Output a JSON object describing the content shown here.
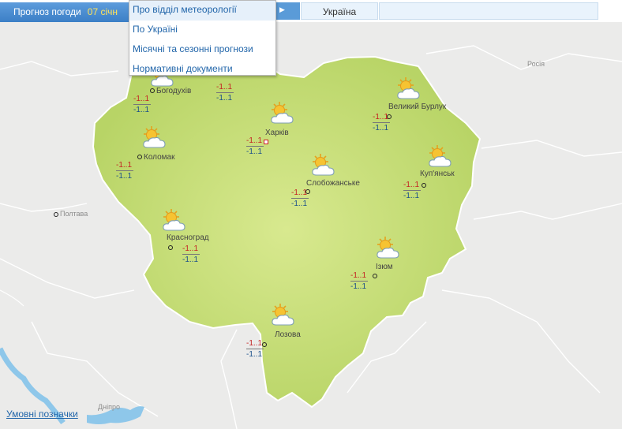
{
  "header": {
    "forecast_label": "Прогноз погоди",
    "date": "07 січн",
    "country_tab": "Україна"
  },
  "menu": {
    "items": [
      {
        "label": "Про відділ метеорології"
      },
      {
        "label": "По Україні"
      },
      {
        "label": "Місячні та сезонні прогнози"
      },
      {
        "label": "Нормативні документи"
      }
    ]
  },
  "map": {
    "neighbors": {
      "russia": "Росія",
      "poltava": "Полтава",
      "dnipro": "Дніпро"
    },
    "region_color": "#c6dc76",
    "cities": [
      {
        "name": "Богодухів",
        "day": "-1..1",
        "night": "-1..1",
        "icon": "sun-cloud-icon"
      },
      {
        "name": "",
        "day": "-1..1",
        "night": "-1..1",
        "icon": "sun-cloud-icon"
      },
      {
        "name": "Великий Бурлук",
        "day": "-1..1",
        "night": "-1..1",
        "icon": "sun-cloud-icon"
      },
      {
        "name": "Харків",
        "day": "-1..1",
        "night": "-1..1",
        "icon": "sun-cloud-icon"
      },
      {
        "name": "Коломак",
        "day": "-1..1",
        "night": "-1..1",
        "icon": "sun-cloud-icon"
      },
      {
        "name": "Слобожанське",
        "day": "-1..1",
        "night": "-1..1",
        "icon": "sun-cloud-icon"
      },
      {
        "name": "Куп'янськ",
        "day": "-1..1",
        "night": "-1..1",
        "icon": "sun-cloud-icon"
      },
      {
        "name": "Красноград",
        "day": "-1..1",
        "night": "-1..1",
        "icon": "sun-cloud-icon"
      },
      {
        "name": "Ізюм",
        "day": "-1..1",
        "night": "-1..1",
        "icon": "sun-cloud-icon"
      },
      {
        "name": "Лозова",
        "day": "-1..1",
        "night": "-1..1",
        "icon": "sun-cloud-icon"
      }
    ]
  },
  "footer": {
    "legend_link": "Умовні позначки"
  }
}
